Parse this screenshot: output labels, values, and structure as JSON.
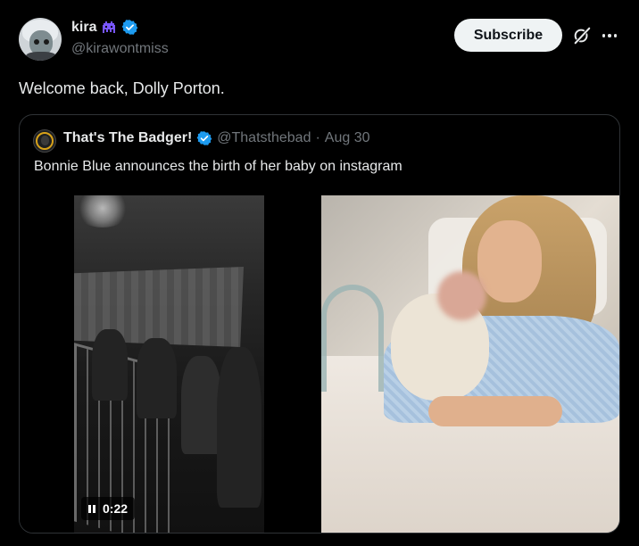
{
  "post": {
    "display_name": "kira",
    "handle": "@kirawontmiss",
    "text": "Welcome back, Dolly Porton.",
    "subscribe_label": "Subscribe"
  },
  "quoted": {
    "display_name": "That's The Badger!",
    "handle": "@Thatsthebad",
    "separator": "·",
    "date": "Aug 30",
    "text": "Bonnie Blue announces the birth of her baby on instagram",
    "video_duration": "0:22"
  },
  "icons": {
    "alien": "alien-monster-icon",
    "verified": "verified-badge-icon",
    "grok": "grok-icon",
    "more": "more-icon",
    "pause": "pause-icon"
  },
  "colors": {
    "background": "#000000",
    "text_primary": "#e7e9ea",
    "text_secondary": "#71767b",
    "verified_blue": "#1d9bf0",
    "border": "#2f3336",
    "alien_purple": "#7856ff"
  }
}
